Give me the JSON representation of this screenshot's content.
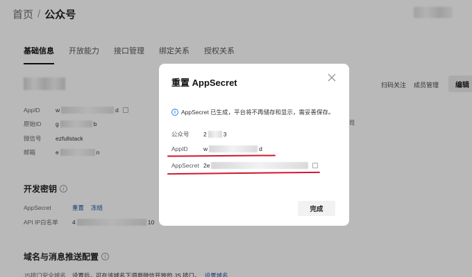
{
  "breadcrumb": {
    "home": "首页",
    "separator": "/",
    "current": "公众号"
  },
  "tabs": [
    {
      "label": "基础信息",
      "active": true
    },
    {
      "label": "开放能力",
      "active": false
    },
    {
      "label": "接口管理",
      "active": false
    },
    {
      "label": "绑定关系",
      "active": false
    },
    {
      "label": "授权关系",
      "active": false
    }
  ],
  "info": {
    "appid_label": "AppID",
    "appid_prefix": "w",
    "appid_suffix": "d",
    "origid_label": "原始ID",
    "origid_prefix": "g",
    "origid_suffix": "b",
    "wechat_label": "微信号",
    "wechat_value": "ezfullstack",
    "email_label": "邮箱",
    "email_prefix": "e",
    "email_suffix": "n"
  },
  "right_col": {
    "scan_follow": "扫码关注",
    "member_manage": "成员管理",
    "edit_label": "编辑",
    "row_char": "司"
  },
  "dev_key": {
    "title": "开发密钥",
    "appsecret_label": "AppSecret",
    "reset_link": "重置",
    "freeze_link": "冻结",
    "whitelist_label": "API IP白名单",
    "whitelist_prefix": "4",
    "whitelist_mid": "10"
  },
  "domain": {
    "title": "域名与消息推送配置",
    "js_label": "JS接口安全域名",
    "js_text": "设置后，可在该域名下调用微信开放的 JS 接口。",
    "js_link": "设置域名"
  },
  "modal": {
    "title": "重置 AppSecret",
    "notice": "AppSecret 已生成，平台将不再储存和显示，需妥善保存。",
    "account_label": "公众号",
    "account_prefix": "2",
    "account_suffix": "3",
    "appid_label": "AppID",
    "appid_prefix": "w",
    "appid_suffix": "d",
    "secret_label": "AppSecret",
    "secret_prefix": "2e",
    "done_label": "完成"
  },
  "colors": {
    "highlight_red": "#d0162a",
    "notice_blue": "#2f7ee0",
    "link_blue": "#1b4fa0"
  }
}
